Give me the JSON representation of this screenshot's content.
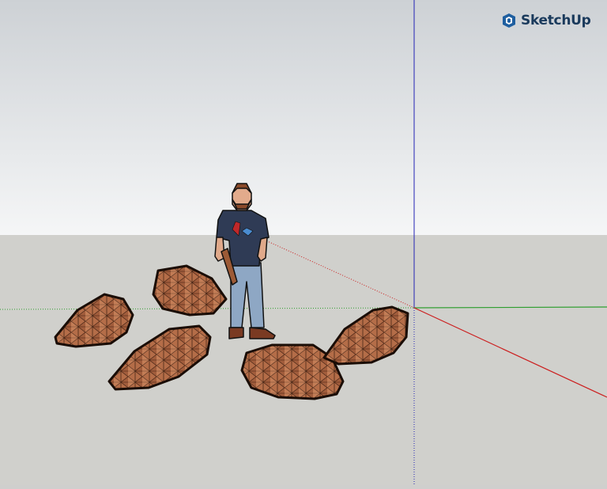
{
  "app": {
    "logo_text": "SketchUp",
    "logo_icon": "sketchup-logo-icon"
  },
  "scene": {
    "sky_top_color": "#cdd1d5",
    "sky_bottom_color": "#f4f5f6",
    "ground_color": "#d0d0cc",
    "axis_colors": {
      "x": "#cc1f1f",
      "y": "#2f9e2f",
      "z": "#2323b5"
    },
    "rock_color": "#b8704a",
    "person_shirt_color": "#2f3b55",
    "person_pants_color": "#8ea7c4"
  }
}
